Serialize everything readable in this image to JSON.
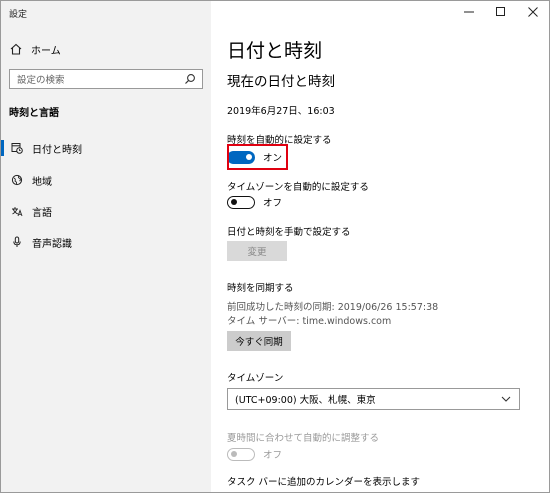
{
  "app_title": "設定",
  "sidebar": {
    "home_label": "ホーム",
    "search_placeholder": "設定の検索",
    "section_title": "時刻と言語",
    "items": [
      {
        "label": "日付と時刻",
        "icon": "calendar-clock-icon",
        "active": true
      },
      {
        "label": "地域",
        "icon": "globe-icon",
        "active": false
      },
      {
        "label": "言語",
        "icon": "language-icon",
        "active": false
      },
      {
        "label": "音声認識",
        "icon": "microphone-icon",
        "active": false
      }
    ]
  },
  "main": {
    "page_title": "日付と時刻",
    "current_heading": "現在の日付と時刻",
    "current_datetime": "2019年6月27日、16:03",
    "auto_time": {
      "label": "時刻を自動的に設定する",
      "state": "オン",
      "on": true
    },
    "auto_timezone": {
      "label": "タイムゾーンを自動的に設定する",
      "state": "オフ",
      "on": false
    },
    "manual": {
      "label": "日付と時刻を手動で設定する",
      "button": "変更"
    },
    "sync": {
      "label": "時刻を同期する",
      "last_sync": "前回成功した時刻の同期: 2019/06/26 15:57:38",
      "server": "タイム サーバー: time.windows.com",
      "button": "今すぐ同期"
    },
    "timezone": {
      "label": "タイムゾーン",
      "value": "(UTC+09:00) 大阪、札幌、東京"
    },
    "dst": {
      "label": "夏時間に合わせて自動的に調整する",
      "state": "オフ"
    },
    "taskbar_calendar_label": "タスク バーに追加のカレンダーを表示します"
  },
  "colors": {
    "accent": "#0067c0",
    "highlight": "#e00010"
  }
}
